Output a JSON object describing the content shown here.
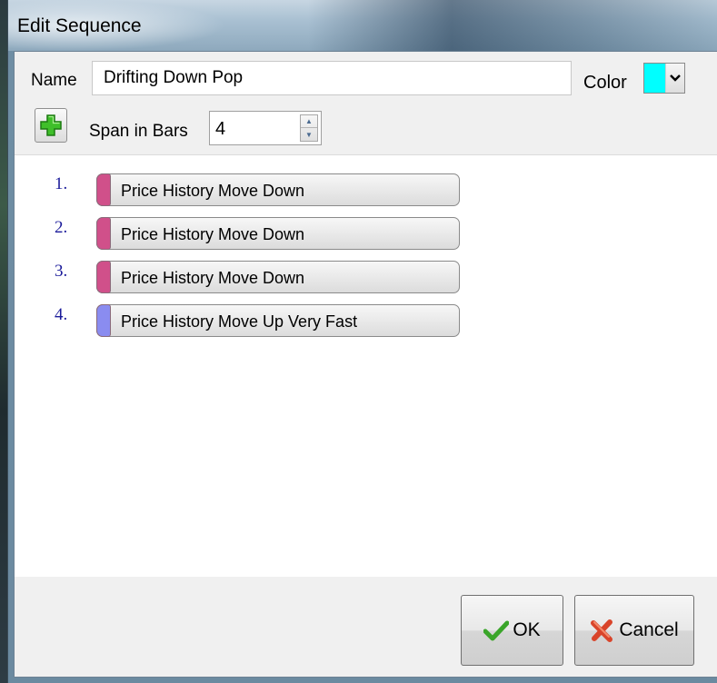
{
  "window": {
    "title": "Edit Sequence"
  },
  "form": {
    "name_label": "Name",
    "name_value": "Drifting Down Pop",
    "color_label": "Color",
    "color_value": "#00ffff",
    "color_dropdown_icon": "chevron-down-icon",
    "add_icon": "plus-icon",
    "span_label": "Span in Bars",
    "span_value": "4"
  },
  "sequence": {
    "items": [
      {
        "number": "1.",
        "label": "Price History Move Down",
        "color": "#d0508a"
      },
      {
        "number": "2.",
        "label": "Price History Move Down",
        "color": "#d0508a"
      },
      {
        "number": "3.",
        "label": "Price History Move Down",
        "color": "#d0508a"
      },
      {
        "number": "4.",
        "label": "Price History Move Up Very Fast",
        "color": "#8a8cf0"
      }
    ]
  },
  "buttons": {
    "ok_label": "OK",
    "ok_icon": "checkmark-icon",
    "cancel_label": "Cancel",
    "cancel_icon": "x-icon"
  }
}
